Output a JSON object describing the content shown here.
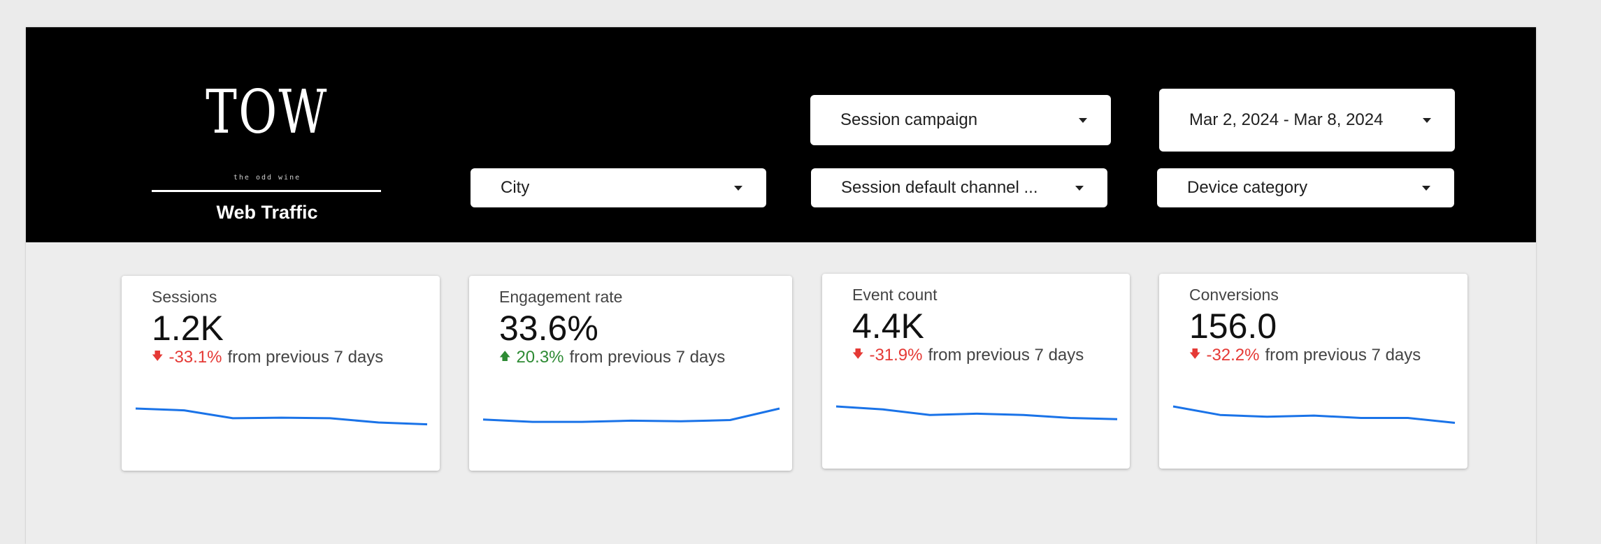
{
  "header": {
    "logo_mark": "TOW",
    "logo_tagline": "the odd wine",
    "report_title": "Web Traffic"
  },
  "filters": {
    "session_campaign": "Session campaign",
    "date_range": "Mar 2, 2024 - Mar 8, 2024",
    "city": "City",
    "session_default_channel": "Session default channel ...",
    "device_category": "Device category"
  },
  "colors": {
    "header_bg": "#000000",
    "sparkline": "#1a73e8",
    "negative": "#e53935",
    "positive": "#2e8b34"
  },
  "cards": [
    {
      "title": "Sessions",
      "value": "1.2K",
      "delta": "-33.1%",
      "direction": "down",
      "comparison": "from previous 7 days",
      "trend": [
        1.0,
        0.97,
        0.84,
        0.85,
        0.84,
        0.77,
        0.74
      ]
    },
    {
      "title": "Engagement rate",
      "value": "33.6%",
      "delta": "20.3%",
      "direction": "up",
      "comparison": "from previous 7 days",
      "trend": [
        0.82,
        0.78,
        0.78,
        0.8,
        0.79,
        0.81,
        1.0
      ]
    },
    {
      "title": "Event count",
      "value": "4.4K",
      "delta": "-31.9%",
      "direction": "down",
      "comparison": "from previous 7 days",
      "trend": [
        1.0,
        0.95,
        0.86,
        0.88,
        0.86,
        0.81,
        0.79
      ]
    },
    {
      "title": "Conversions",
      "value": "156.0",
      "delta": "-32.2%",
      "direction": "down",
      "comparison": "from previous 7 days",
      "trend": [
        1.0,
        0.86,
        0.83,
        0.85,
        0.81,
        0.81,
        0.73
      ]
    }
  ]
}
